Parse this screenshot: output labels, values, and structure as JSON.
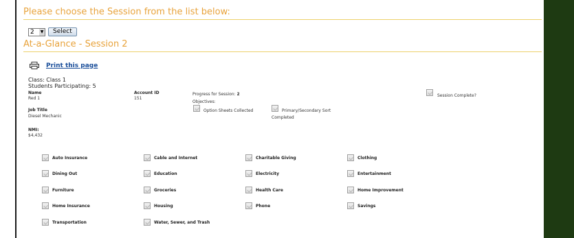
{
  "header": {
    "choose_session": "Please choose the Session from the list below:"
  },
  "session_select": {
    "value": "2",
    "button_label": "Select"
  },
  "glance_title": "At-a-Glance - Session 2",
  "print_link": "Print this page",
  "class_info": {
    "class_line": "Class: Class 1",
    "students_line": "Students Participating: 5"
  },
  "student": {
    "name_label": "Name",
    "name_value": "Red 1",
    "account_label": "Account ID",
    "account_value": "151",
    "job_label": "Job Title",
    "job_value": "Diesel Mechanic",
    "nmi_label": "NMI:",
    "nmi_value": "$4,432"
  },
  "progress": {
    "label": "Progress for Session:",
    "value": "2",
    "objectives_label": "Objectives:",
    "option_sheets": "Option Sheets Collected",
    "primary_secondary": "Primary/Secondary Sort",
    "completed": "Completed",
    "session_complete": "Session Complete?"
  },
  "categories": [
    "Auto Insurance",
    "Cable and Internet",
    "Charitable Giving",
    "Clothing",
    "Dining Out",
    "Education",
    "Electricity",
    "Entertainment",
    "Furniture",
    "Groceries",
    "Health Care",
    "Home Improvement",
    "Home Insurance",
    "Housing",
    "Phone",
    "Savings",
    "Transportation",
    "Water, Sewer, and Trash"
  ],
  "colors": {
    "heading": "#e8a33c",
    "rule": "#ecd16a",
    "side_band": "#1e3a12",
    "link": "#1a4e9a"
  }
}
